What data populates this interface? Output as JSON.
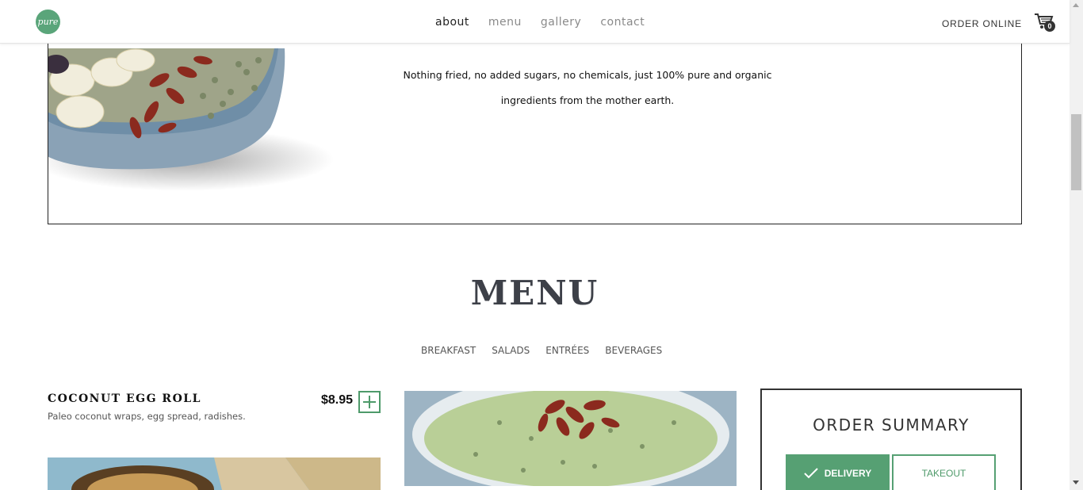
{
  "header": {
    "logo_text": "pure",
    "nav": [
      {
        "label": "about",
        "active": true
      },
      {
        "label": "menu",
        "active": false
      },
      {
        "label": "gallery",
        "active": false
      },
      {
        "label": "contact",
        "active": false
      }
    ],
    "order_online": "ORDER ONLINE",
    "cart_count": "0",
    "cart_icon": "shopping-cart-icon"
  },
  "about": {
    "line1": "Nothing fried, no added sugars, no chemicals, just 100% pure and organic",
    "line2": "ingredients from the mother earth."
  },
  "menu": {
    "title": "MENU",
    "tabs": [
      "BREAKFAST",
      "SALADS",
      "ENTRÉES",
      "BEVERAGES"
    ],
    "item": {
      "name": "COCONUT EGG ROLL",
      "description": "Paleo coconut wraps, egg spread, radishes.",
      "price": "$8.95",
      "add_icon": "plus-icon"
    }
  },
  "order_summary": {
    "title": "ORDER SUMMARY",
    "delivery": "DELIVERY",
    "takeout": "TAKEOUT",
    "check_icon": "check-icon"
  },
  "colors": {
    "accent": "#56a073",
    "text_dark": "#3d4048"
  }
}
